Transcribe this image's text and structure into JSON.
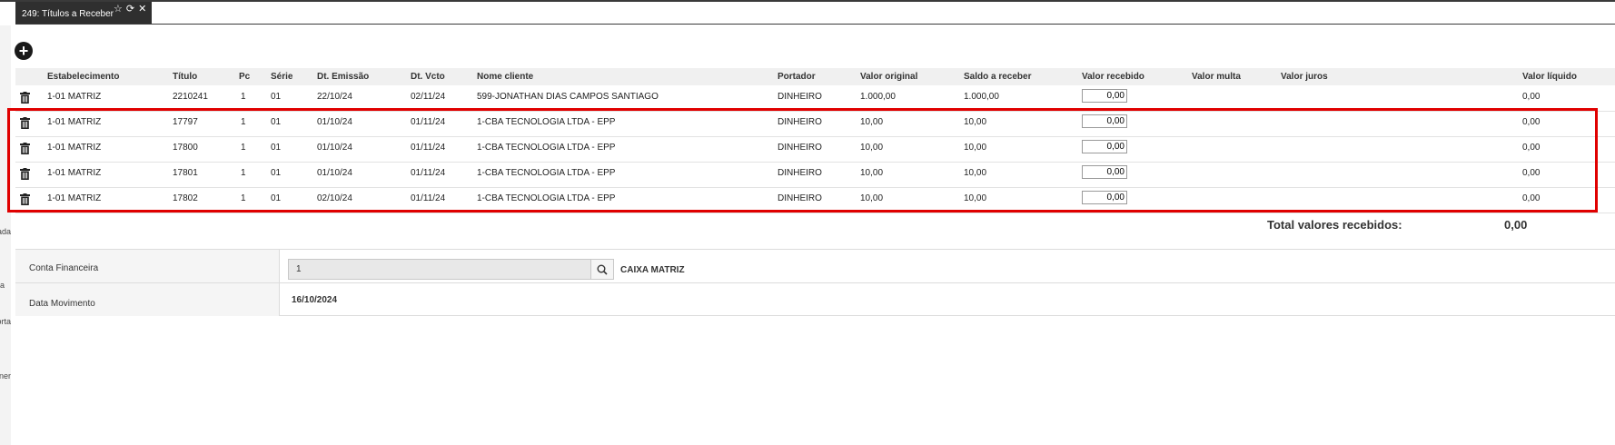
{
  "tab": {
    "title": "249: Títulos a Receber",
    "icons": [
      "star-outline-icon",
      "refresh-icon",
      "close-icon"
    ]
  },
  "gutter_fragments": [
    "ada",
    "a",
    "orta",
    "ner"
  ],
  "table": {
    "headers": {
      "estabelecimento": "Estabelecimento",
      "titulo": "Título",
      "pc": "Pc",
      "serie": "Série",
      "dt_emissao": "Dt. Emissão",
      "dt_vcto": "Dt. Vcto",
      "nome_cliente": "Nome cliente",
      "portador": "Portador",
      "valor_original": "Valor original",
      "saldo_receber": "Saldo a receber",
      "valor_recebido": "Valor recebido",
      "valor_multa": "Valor multa",
      "valor_juros": "Valor juros",
      "valor_liquido": "Valor líquido"
    },
    "rows": [
      {
        "estabelecimento": "1-01 MATRIZ",
        "titulo": "2210241",
        "pc": "1",
        "serie": "01",
        "dt_emissao": "22/10/24",
        "dt_vcto": "02/11/24",
        "nome_cliente": "599-JONATHAN DIAS CAMPOS SANTIAGO",
        "portador": "DINHEIRO",
        "valor_original": "1.000,00",
        "saldo_receber": "1.000,00",
        "valor_recebido": "0,00",
        "valor_liquido": "0,00"
      },
      {
        "estabelecimento": "1-01 MATRIZ",
        "titulo": "17797",
        "pc": "1",
        "serie": "01",
        "dt_emissao": "01/10/24",
        "dt_vcto": "01/11/24",
        "nome_cliente": "1-CBA TECNOLOGIA LTDA - EPP",
        "portador": "DINHEIRO",
        "valor_original": "10,00",
        "saldo_receber": "10,00",
        "valor_recebido": "0,00",
        "valor_liquido": "0,00"
      },
      {
        "estabelecimento": "1-01 MATRIZ",
        "titulo": "17800",
        "pc": "1",
        "serie": "01",
        "dt_emissao": "01/10/24",
        "dt_vcto": "01/11/24",
        "nome_cliente": "1-CBA TECNOLOGIA LTDA - EPP",
        "portador": "DINHEIRO",
        "valor_original": "10,00",
        "saldo_receber": "10,00",
        "valor_recebido": "0,00",
        "valor_liquido": "0,00"
      },
      {
        "estabelecimento": "1-01 MATRIZ",
        "titulo": "17801",
        "pc": "1",
        "serie": "01",
        "dt_emissao": "01/10/24",
        "dt_vcto": "01/11/24",
        "nome_cliente": "1-CBA TECNOLOGIA LTDA - EPP",
        "portador": "DINHEIRO",
        "valor_original": "10,00",
        "saldo_receber": "10,00",
        "valor_recebido": "0,00",
        "valor_liquido": "0,00"
      },
      {
        "estabelecimento": "1-01 MATRIZ",
        "titulo": "17802",
        "pc": "1",
        "serie": "01",
        "dt_emissao": "02/10/24",
        "dt_vcto": "01/11/24",
        "nome_cliente": "1-CBA TECNOLOGIA LTDA - EPP",
        "portador": "DINHEIRO",
        "valor_original": "10,00",
        "saldo_receber": "10,00",
        "valor_recebido": "0,00",
        "valor_liquido": "0,00"
      }
    ]
  },
  "totals": {
    "label": "Total valores recebidos:",
    "value": "0,00"
  },
  "form": {
    "conta_label": "Conta Financeira",
    "conta_value": "1",
    "conta_desc": "CAIXA MATRIZ",
    "data_label": "Data Movimento",
    "data_value": "16/10/2024"
  },
  "colors": {
    "tab_bg": "#2f2f2f",
    "highlight": "#e00000",
    "header_bg": "#f0f0f0"
  }
}
